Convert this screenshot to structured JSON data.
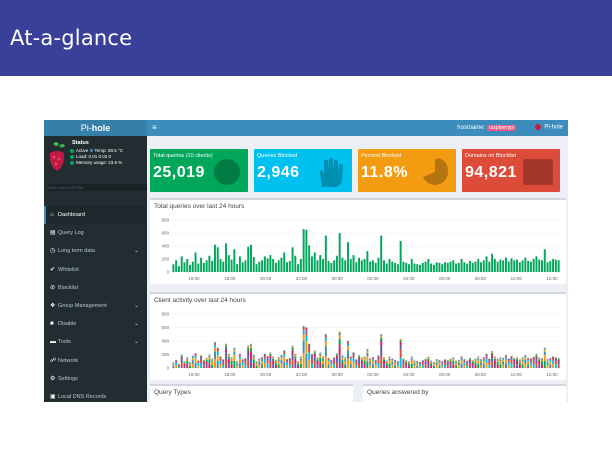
{
  "slide": {
    "title": "At-a-glance"
  },
  "app": {
    "logo_prefix": "Pi-",
    "logo_bold": "hole",
    "hostname_label": "hostname:",
    "hostname": "raspberrypi",
    "user": "Pi-hole"
  },
  "status": {
    "title": "Status",
    "active": "Active",
    "temp": "Temp: 58.5 °C",
    "load": "Load: 0.01 0.02 0",
    "memory": "Memory usage: 23.6 %",
    "nav_header": "MAIN NAVIGATION"
  },
  "menu": [
    {
      "label": "Dashboard",
      "icon": "home-icon",
      "glyph": "⌂",
      "active": true,
      "chevron": false
    },
    {
      "label": "Query Log",
      "icon": "file-icon",
      "glyph": "▤",
      "active": false,
      "chevron": false
    },
    {
      "label": "Long term data",
      "icon": "clock-icon",
      "glyph": "◷",
      "active": false,
      "chevron": true
    },
    {
      "label": "Whitelist",
      "icon": "check-circle-icon",
      "glyph": "✔",
      "active": false,
      "chevron": false
    },
    {
      "label": "Blacklist",
      "icon": "ban-icon",
      "glyph": "⊘",
      "active": false,
      "chevron": false
    },
    {
      "label": "Group Management",
      "icon": "users-icon",
      "glyph": "❖",
      "active": false,
      "chevron": true
    },
    {
      "label": "Disable",
      "icon": "stop-icon",
      "glyph": "■",
      "active": false,
      "chevron": true
    },
    {
      "label": "Tools",
      "icon": "folder-icon",
      "glyph": "▬",
      "active": false,
      "chevron": true
    },
    {
      "label": "Network",
      "icon": "network-icon",
      "glyph": "☍",
      "active": false,
      "chevron": false
    },
    {
      "label": "Settings",
      "icon": "gears-icon",
      "glyph": "⚙",
      "active": false,
      "chevron": false
    },
    {
      "label": "Local DNS Records",
      "icon": "address-book-icon",
      "glyph": "▣",
      "active": false,
      "chevron": false
    }
  ],
  "stats": {
    "total_label": "Total queries (10 clients)",
    "total_value": "25,019",
    "blocked_label": "Queries Blocked",
    "blocked_value": "2,946",
    "percent_label": "Percent Blocked",
    "percent_value": "11.8%",
    "domains_label": "Domains on Blocklist",
    "domains_value": "94,821"
  },
  "colors": {
    "green": "#00a65a",
    "aqua": "#00c0ef",
    "yellow": "#f39c12",
    "red": "#dd4b39",
    "header": "#3c8dbc",
    "slide_title": "#3a3f9a"
  },
  "panels": {
    "queries_title": "Total queries over last 24 hours",
    "clients_title": "Client activity over last 24 hours",
    "query_types_title": "Query Types",
    "answered_by_title": "Queries answered by"
  },
  "chart_data": [
    {
      "type": "bar",
      "title": "Total queries over last 24 hours",
      "ylim": [
        0,
        800
      ],
      "yticks": [
        "800",
        "600",
        "400",
        "200",
        "0"
      ],
      "xticks": [
        "16:00",
        "18:00",
        "20:00",
        "22:00",
        "00:00",
        "02:00",
        "04:00",
        "06:00",
        "08:00",
        "10:00",
        "12:00"
      ],
      "values": [
        120,
        180,
        90,
        240,
        150,
        200,
        110,
        160,
        300,
        130,
        220,
        140,
        180,
        250,
        170,
        420,
        380,
        200,
        160,
        440,
        260,
        190,
        350,
        120,
        240,
        150,
        180,
        390,
        420,
        230,
        120,
        160,
        180,
        240,
        210,
        260,
        200,
        140,
        180,
        220,
        300,
        150,
        170,
        380,
        250,
        120,
        200,
        660,
        650,
        410,
        240,
        300,
        180,
        260,
        200,
        560,
        170,
        140,
        180,
        250,
        600,
        220,
        180,
        460,
        200,
        260,
        150,
        220,
        180,
        200,
        320,
        160,
        180,
        140,
        220,
        560,
        180,
        130,
        200,
        160,
        140,
        120,
        480,
        160,
        140,
        120,
        200,
        130,
        120,
        110,
        140,
        160,
        200,
        130,
        110,
        150,
        140,
        120,
        150,
        140,
        160,
        180,
        130,
        140,
        200,
        150,
        130,
        170,
        140,
        160,
        200,
        150,
        180,
        240,
        160,
        280,
        200,
        160,
        190,
        180,
        220,
        160,
        210,
        180,
        190,
        150,
        180,
        220,
        170,
        160,
        200,
        240,
        190,
        180,
        350,
        150,
        170,
        200,
        190,
        180
      ]
    },
    {
      "type": "bar",
      "title": "Client activity over last 24 hours",
      "ylim": [
        0,
        800
      ],
      "yticks": [
        "800",
        "600",
        "400",
        "200",
        "0"
      ],
      "xticks": [
        "16:00",
        "18:00",
        "20:00",
        "22:00",
        "00:00",
        "02:00",
        "04:00",
        "06:00",
        "08:00",
        "10:00",
        "12:00"
      ],
      "values": [
        80,
        120,
        60,
        200,
        100,
        160,
        90,
        180,
        220,
        110,
        190,
        120,
        150,
        200,
        140,
        380,
        300,
        170,
        130,
        360,
        210,
        160,
        300,
        100,
        210,
        130,
        150,
        330,
        360,
        200,
        100,
        140,
        160,
        210,
        180,
        230,
        170,
        120,
        160,
        190,
        260,
        130,
        150,
        330,
        210,
        100,
        170,
        620,
        600,
        360,
        210,
        260,
        160,
        230,
        170,
        500,
        150,
        120,
        160,
        220,
        540,
        190,
        160,
        400,
        170,
        230,
        130,
        190,
        160,
        170,
        280,
        140,
        160,
        120,
        190,
        500,
        160,
        110,
        170,
        140,
        120,
        100,
        430,
        140,
        120,
        100,
        170,
        110,
        100,
        90,
        120,
        140,
        170,
        110,
        90,
        130,
        120,
        100,
        130,
        120,
        140,
        160,
        110,
        120,
        170,
        130,
        110,
        150,
        120,
        140,
        170,
        130,
        160,
        210,
        140,
        250,
        170,
        140,
        160,
        150,
        190,
        140,
        180,
        150,
        160,
        130,
        160,
        190,
        150,
        140,
        170,
        210,
        160,
        150,
        300,
        130,
        150,
        170,
        160,
        150
      ]
    }
  ]
}
